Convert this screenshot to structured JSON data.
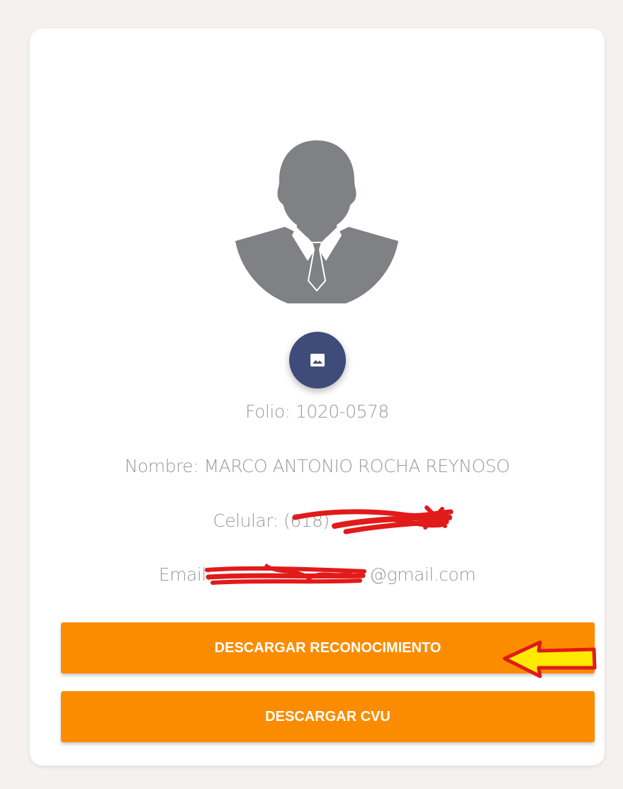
{
  "profile": {
    "folio_label": "Folio:",
    "folio_value": "1020-0578",
    "nombre_label": "Nombre:",
    "nombre_value": "MARCO ANTONIO ROCHA REYNOSO",
    "celular_label": "Celular:",
    "celular_visible": "(618)",
    "email_label": "Email:",
    "email_visible": "@gmail.com"
  },
  "icons": {
    "avatar": "user-silhouette-icon",
    "photo_button": "image-icon",
    "annotation": "arrow-left-icon"
  },
  "buttons": {
    "download_recognition": "DESCARGAR RECONOCIMIENTO",
    "download_cvu": "DESCARGAR CVU"
  },
  "colors": {
    "accent": "#fb8c00",
    "photo_button": "#3f4b79",
    "avatar": "#7f8184",
    "info_text": "#9a9a9a",
    "redaction": "#e11a1a",
    "annotation_arrow_fill": "#ffe900",
    "annotation_arrow_stroke": "#e01a1a"
  }
}
